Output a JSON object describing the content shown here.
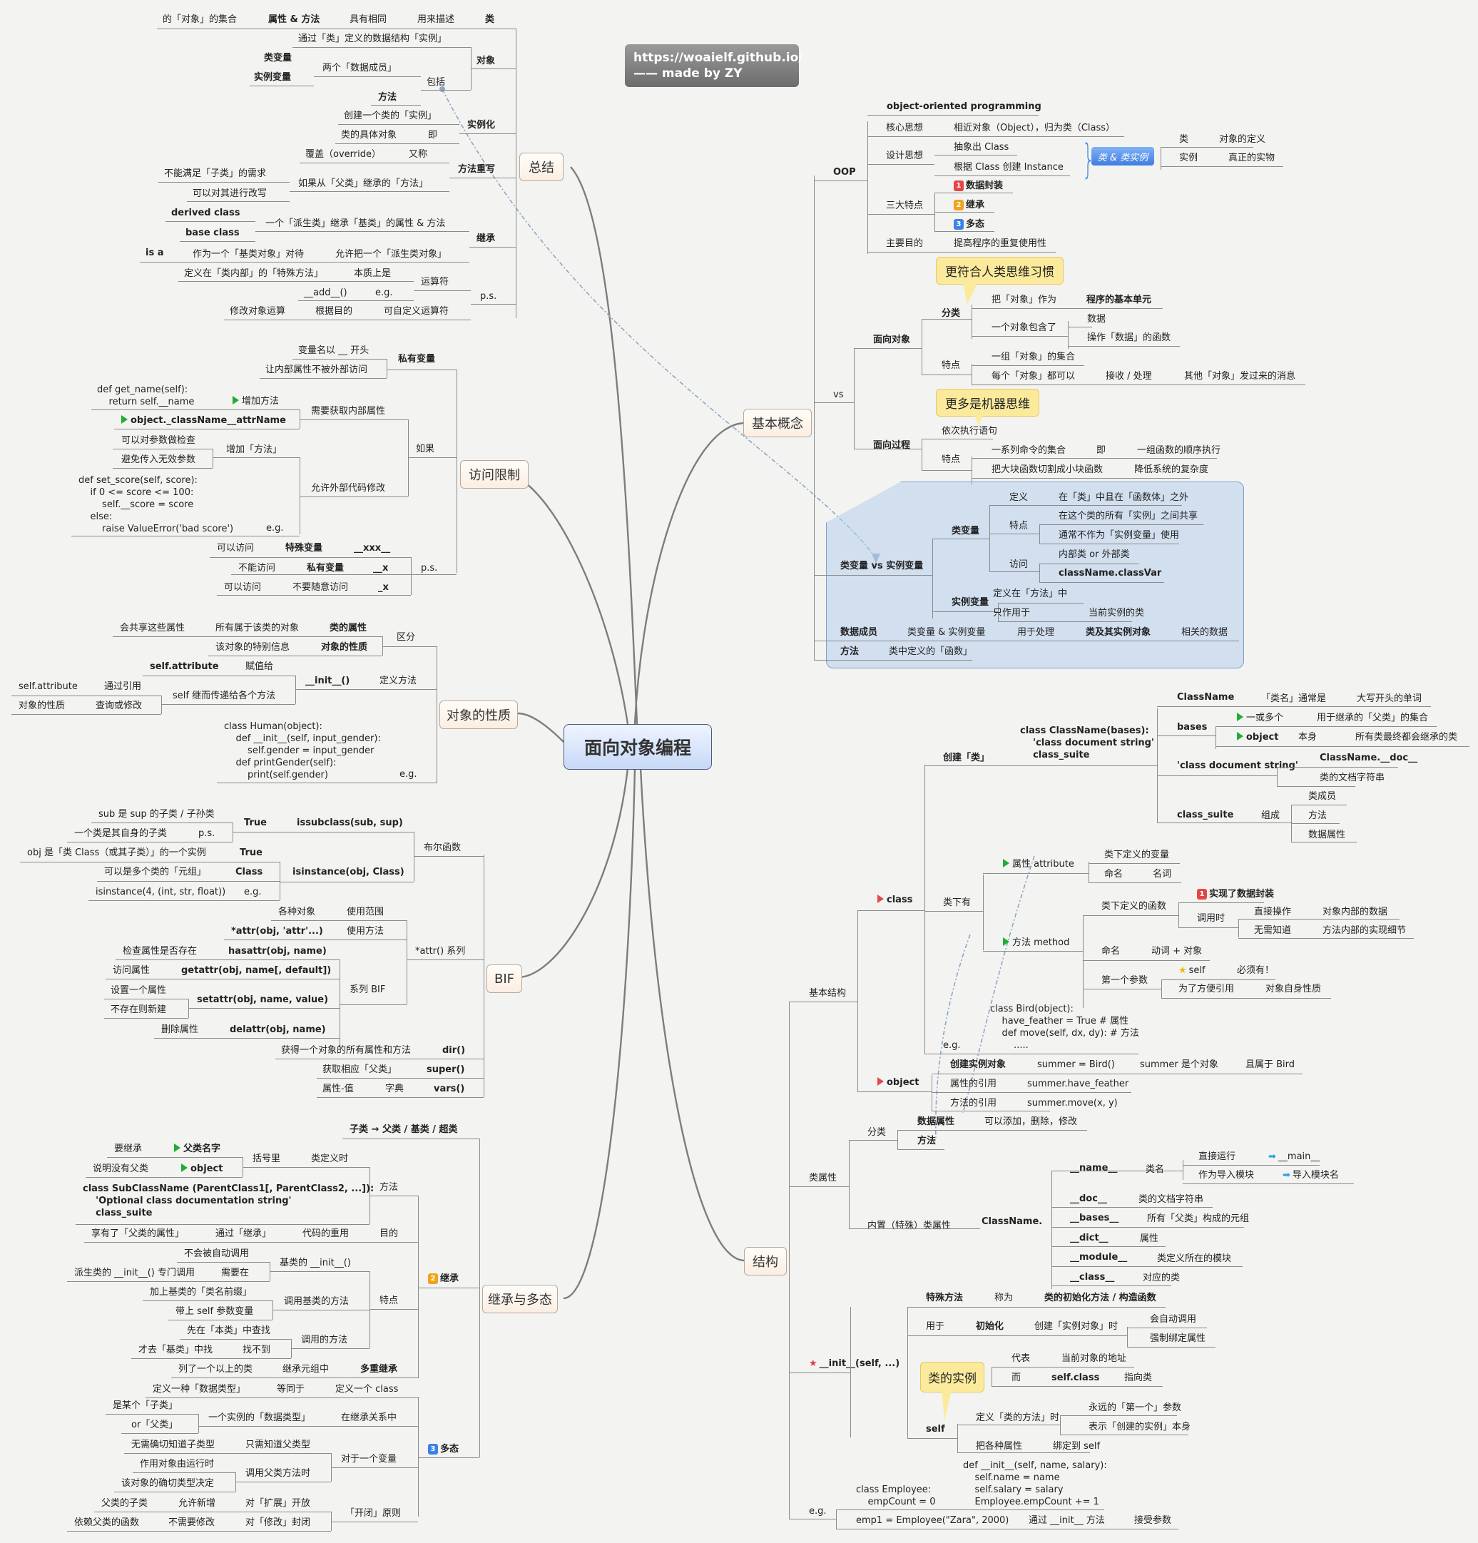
{
  "center": "面向对象编程",
  "signature": {
    "line1": "https://woaielf.github.io/",
    "line2": "—— made by ZY"
  },
  "topics": {
    "summary": "总结",
    "basic": "基本概念",
    "access": "访问限制",
    "props": "对象的性质",
    "bif": "BIF",
    "inherit": "继承与多态",
    "structure": "结构"
  },
  "callouts": {
    "human": "更符合人类思维习惯",
    "machine": "更多是机器思维",
    "instance": "类的实例"
  },
  "chip": "类 & 类实例",
  "summary": {
    "cls": [
      "的「对象」的集合",
      "属性 & 方法",
      "具有相同",
      "用来描述",
      "类"
    ],
    "obj_label": "对象",
    "obj_def": "通过「类」定义的数据结构「实例」",
    "class_var": "类变量",
    "inst_var": "实例变量",
    "two_members": "两个「数据成员」",
    "include": "包括",
    "method": "方法",
    "instantiate": "实例化",
    "create_inst": "创建一个类的「实例」",
    "concrete": "类的具体对象",
    "ie": "即",
    "override_label": "方法重写",
    "override": "覆盖（override）",
    "aka": "又称",
    "not_satisfy": "不能满足「子类」的需求",
    "can_rewrite": "可以对其进行改写",
    "if_inherit": "如果从「父类」继承的「方法」",
    "inherit_label": "继承",
    "derived": "derived class",
    "base": "base class",
    "derived_inherits": "一个「派生类」继承「基类」的属性 & 方法",
    "isa": "is a",
    "treat_as": "作为一个「基类对象」对待",
    "allow": "允许把一个「派生类对象」",
    "defined_inside": "定义在「类内部」的「特殊方法」",
    "essentially": "本质上是",
    "operator": "运算符",
    "add": "__add__()",
    "eg": "e.g.",
    "ps": "p.s.",
    "modify_op": "修改对象运算",
    "by_purpose": "根据目的",
    "custom_op": "可自定义运算符"
  },
  "basic": {
    "oop": "OOP",
    "oop_full": "object-oriented programming",
    "core": "核心思想",
    "core_val": "相近对象（Object），归为类（Class）",
    "design": "设计思想",
    "abstract": "抽象出 Class",
    "create": "根据 Class 创建 Instance",
    "cls": "类",
    "cls_def": "对象的定义",
    "inst": "实例",
    "inst_def": "真正的实物",
    "three": "三大特点",
    "f1": "数据封装",
    "f2": "继承",
    "f3": "多态",
    "goal": "主要目的",
    "goal_val": "提高程序的重复使用性",
    "vs": "vs",
    "oo": "面向对象",
    "classify": "分类",
    "take": "把「对象」作为",
    "unit": "程序的基本单元",
    "contains": "一个对象包含了",
    "data": "数据",
    "ops": "操作「数据」的函数",
    "trait": "特点",
    "group": "一组「对象」的集合",
    "each": "每个「对象」都可以",
    "recv": "接收 / 处理",
    "msg": "其他「对象」发过来的消息",
    "po": "面向过程",
    "seq": "依次执行语句",
    "cmds": "一系列命令的集合",
    "ie": "即",
    "funcs": "一组函数的顺序执行",
    "split": "把大块函数切割成小块函数",
    "reduce": "降低系统的复杂度",
    "cv_vs_iv": "类变量 vs 实例变量",
    "cv": "类变量",
    "def": "定义",
    "def_val": "在「类」中且在「函数体」之外",
    "trait2": "特点",
    "shared": "在这个类的所有「实例」之间共享",
    "not_iv": "通常不作为「实例变量」使用",
    "access": "访问",
    "inner": "内部类 or 外部类",
    "classvar": "className.classVar",
    "iv": "实例变量",
    "iv_def": "定义在「方法」中",
    "only": "只作用于",
    "cur": "当前实例的类",
    "dm": "数据成员",
    "dm_val": "类变量 & 实例变量",
    "for": "用于处理",
    "cls_obj": "类及其实例对象",
    "related": "相关的数据",
    "method": "方法",
    "method_val": "类中定义的「函数」"
  },
  "access": {
    "private": "私有变量",
    "prefix": "变量名以 __ 开头",
    "hide": "让内部属性不被外部访问",
    "code1": "def get_name(self):\n    return self.__name",
    "add_method": "增加方法",
    "mangled": "object._className__attrName",
    "need_get": "需要获取内部属性",
    "if": "如果",
    "check": "可以对参数做检查",
    "avoid": "避免传入无效参数",
    "add_method2": "增加「方法」",
    "code2": "def set_score(self, score):\n    if 0 <= score <= 100:\n        self.__score = score\n    else:\n        raise ValueError('bad score')",
    "eg": "e.g.",
    "allow_mod": "允许外部代码修改",
    "ps_rows": [
      [
        "可以访问",
        "特殊变量",
        "__xxx__"
      ],
      [
        "不能访问",
        "私有变量",
        "__x"
      ],
      [
        "可以访问",
        "不要随意访问",
        "_x"
      ]
    ],
    "ps": "p.s."
  },
  "props": {
    "share": "会共享这些属性",
    "all_objs": "所有属于该类的对象",
    "cls_attr": "类的属性",
    "distinguish": "区分",
    "special": "该对象的特别信息",
    "obj_nature": "对象的性质",
    "self_attr": "self.attribute",
    "assign": "赋值给",
    "init": "__init__()",
    "define": "定义方法",
    "self_attr2": "self.attribute",
    "via_ref": "通过引用",
    "pass_self": "self 继而传递给各个方法",
    "nature2": "对象的性质",
    "query": "查询或修改",
    "code": "class Human(object):\n    def __init__(self, input_gender):\n        self.gender = input_gender\n    def printGender(self):\n        print(self.gender)",
    "eg": "e.g."
  },
  "bif": {
    "sub_sup": "sub 是 sup 的子类 / 子孙类",
    "true1": "True",
    "issubclass": "issubclass(sub, sup)",
    "self_sub": "一个类是其自身的子类",
    "ps": "p.s.",
    "bool": "布尔函数",
    "obj_is": "obj 是「类 Class（或其子类）」的一个实例",
    "true2": "True",
    "tuple": "可以是多个类的「元组」",
    "cls": "Class",
    "isinstance": "isinstance(obj, Class)",
    "isinstance_eg": "isinstance(4, (int, str, float))",
    "eg": "e.g.",
    "various": "各种对象",
    "scope": "使用范围",
    "attr_pat": "*attr(obj, 'attr'...)",
    "usage": "使用方法",
    "attr_series": "*attr() 系列",
    "check": "检查属性是否存在",
    "hasattr": "hasattr(obj, name)",
    "access": "访问属性",
    "getattr": "getattr(obj, name[, default])",
    "series_bif": "系列 BIF",
    "set": "设置一个属性",
    "setattr": "setattr(obj, name, value)",
    "create": "不存在则新建",
    "del": "删除属性",
    "delattr": "delattr(obj, name)",
    "dir_desc": "获得一个对象的所有属性和方法",
    "dir": "dir()",
    "super_desc": "获取相应「父类」",
    "super": "super()",
    "kv": "属性-值",
    "dict": "字典",
    "vars": "vars()"
  },
  "inherit": {
    "chain": "子类 → 父类 / 基类 / 超类",
    "to_inherit": "要继承",
    "parent_name": "父类名字",
    "in_paren": "括号里",
    "when_def": "类定义时",
    "no_parent": "说明没有父类",
    "object": "object",
    "code": "class SubClassName (ParentClass1[, ParentClass2, ...]):\n    'Optional class documentation string'\n    class_suite",
    "method": "方法",
    "enjoy": "享有了「父类的属性」",
    "via": "通过「继承」",
    "reuse": "代码的重用",
    "purpose": "目的",
    "no_auto": "不会被自动调用",
    "base_init": "基类的 __init__()",
    "derived_call": "派生类的 __init__() 专门调用",
    "need": "需要在",
    "prefix": "加上基类的「类名前缀」",
    "call_base": "调用基类的方法",
    "trait": "特点",
    "with_self": "带上 self 参数变量",
    "first": "先在「本类」中查找",
    "call_method": "调用的方法",
    "then": "才去「基类」中找",
    "not_found": "找不到",
    "listed": "列了一个以上的类",
    "in_tuple": "继承元组中",
    "multi": "多重继承",
    "inherit_label": "继承",
    "poly_label": "多态",
    "def_type": "定义一种「数据类型」",
    "equal": "等同于",
    "def_class": "定义一个 class",
    "some_sub": "是某个「子类」",
    "inst_type": "一个实例的「数据类型」",
    "in_rel": "在继承关系中",
    "or_parent": "or「父类」",
    "no_need": "无需确切知道子类型",
    "only_parent": "只需知道父类型",
    "for_var": "对于一个变量",
    "runtime": "作用对象由运行时",
    "call_parent": "调用父类方法时",
    "exact": "该对象的确切类型决定",
    "sub_of": "父类的子类",
    "allow_add": "允许新增",
    "open_ext": "对「扩展」开放",
    "oc": "「开闭」原则",
    "rely": "依赖父类的函数",
    "no_modify": "不需要修改",
    "closed_mod": "对「修改」封闭"
  },
  "structure": {
    "basic_struct": "基本结构",
    "class": "class",
    "create_cls": "创建「类」",
    "cls_code": "class ClassName(bases):\n    'class document string'\n    class_suite",
    "classname": "ClassName",
    "name_usual": "「类名」通常是",
    "capital": "大写开头的单词",
    "bases": "bases",
    "one_or_more": "一或多个",
    "parent_set": "用于继承的「父类」的集合",
    "object": "object",
    "itself": "本身",
    "all_inherit": "所有类最终都会继承的类",
    "docstring": "'class document string'",
    "doc_attr": "ClassName.__doc__",
    "doc_desc": "类的文档字符串",
    "suite": "class_suite",
    "compose": "组成",
    "members": "类成员",
    "methods": "方法",
    "data_attrs": "数据属性",
    "under": "类下有",
    "attr": "属性 attribute",
    "attr_def": "类下定义的变量",
    "naming": "命名",
    "noun": "名词",
    "encap": "实现了数据封装",
    "func_def": "类下定义的函数",
    "when_call": "调用时",
    "direct": "直接操作",
    "inner_data": "对象内部的数据",
    "no_know": "无需知道",
    "impl": "方法内部的实现细节",
    "method": "方法 method",
    "naming2": "命名",
    "verb": "动词 + 对象",
    "first_param": "第一个参数",
    "self": "self",
    "must": "必须有！",
    "convenient": "为了方便引用",
    "self_nature": "对象自身性质",
    "bird_code": "class Bird(object):\n    have_feather = True # 属性\n    def move(self, dx, dy): # 方法\n        .....",
    "eg": "e.g.",
    "obj": "object",
    "create_inst": "创建实例对象",
    "summer": "summer = Bird()",
    "is_obj": "summer 是个对象",
    "of_bird": "且属于 Bird",
    "attr_ref": "属性的引用",
    "summer_attr": "summer.have_feather",
    "method_ref": "方法的引用",
    "summer_move": "summer.move(x, y)",
    "cls_attrs": "类属性",
    "classify": "分类",
    "data_attr": "数据属性",
    "mutable": "可以添加，删除，修改",
    "method2": "方法",
    "builtin": "内置（特殊）类属性",
    "classname_dot": "ClassName.",
    "name": "__name__",
    "cls_name": "类名",
    "run_direct": "直接运行",
    "main": "__main__",
    "as_import": "作为导入模块",
    "mod_name": "导入模块名",
    "doc": "__doc__",
    "doc_str": "类的文档字符串",
    "bases2": "__bases__",
    "bases_desc": "所有「父类」构成的元组",
    "dict": "__dict__",
    "attrs": "属性",
    "module": "__module__",
    "module_desc": "类定义所在的模块",
    "cls": "__class__",
    "cls_desc": "对应的类",
    "init": "__init__(self, ...)",
    "special": "特殊方法",
    "called": "称为",
    "ctor": "类的初始化方法 / 构造函数",
    "used_for": "用于",
    "initialize": "初始化",
    "when_create": "创建「实例对象」时",
    "auto": "会自动调用",
    "force": "强制绑定属性",
    "represents": "代表",
    "addr": "当前对象的地址",
    "while": "而",
    "selfclass": "self.class",
    "points": "指向类",
    "self2": "self",
    "define_method": "定义「类的方法」时",
    "always_first": "永远的「第一个」参数",
    "represents_inst": "表示「创建的实例」本身",
    "bind": "把各种属性",
    "bind_self": "绑定到 self",
    "emp_code": "class Employee:\n    empCount = 0",
    "init_code": "def __init__(self, name, salary):\n    self.name = name\n    self.salary = salary\n    Employee.empCount += 1",
    "eg2": "e.g.",
    "emp1": "emp1 = Employee(\"Zara\", 2000)",
    "via_init": "通过 __init__ 方法",
    "accept": "接受参数"
  }
}
